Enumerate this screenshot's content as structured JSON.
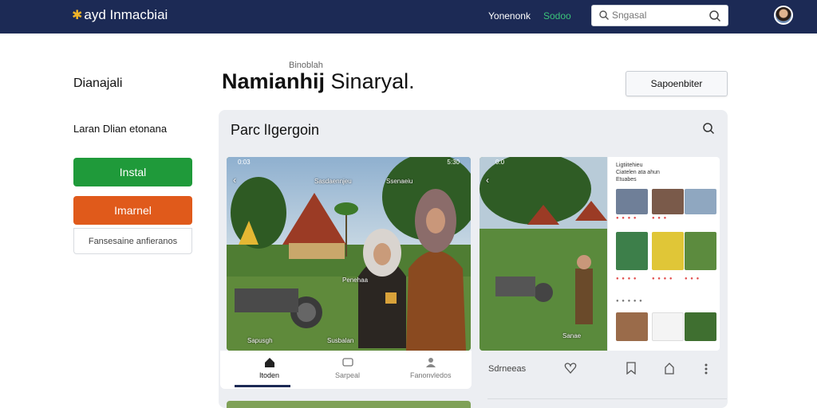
{
  "header": {
    "brand": "ayd Inmacbiai",
    "nav_primary": "Yonenonk",
    "nav_secondary": "Sodoo",
    "search_placeholder": "Sngasal",
    "brand_color": "#1c2a55"
  },
  "sidebar": {
    "title": "Dianajali",
    "subtitle": "Laran Dlian etonana",
    "install_label": "Instal",
    "secondary_label": "Imarnel",
    "outline_label": "Fansesaine anfieranos",
    "colors": {
      "install": "#1f9a3a",
      "secondary": "#e05a1b"
    }
  },
  "page": {
    "kicker": "Binoblah",
    "title_bold": "Namianhij",
    "title_regular": "Sinaryal.",
    "action_button": "Sapoenbiter"
  },
  "card": {
    "title": "Parc lIgergoin",
    "media1": {
      "status_time": "0:03",
      "status_right": "5:30",
      "label_left": "Sasdaennjeu",
      "label_right": "Ssenaeiu",
      "label_bottom_left": "Sapusgh",
      "label_bottom_mid": "Susbalan",
      "label_mid": "Penehaa"
    },
    "media2": {
      "status": "0:0",
      "label": "Sanae"
    },
    "tabs": [
      {
        "label": "Itoden",
        "icon": "home-icon"
      },
      {
        "label": "Sarpeal",
        "icon": "message-icon"
      },
      {
        "label": "Fanonvledos",
        "icon": "person-icon"
      }
    ],
    "actions_label": "Sdrneeas",
    "feed_header": [
      "Ligtiitehieu",
      "Ciatelen ata ahun",
      "Etuabes"
    ]
  }
}
